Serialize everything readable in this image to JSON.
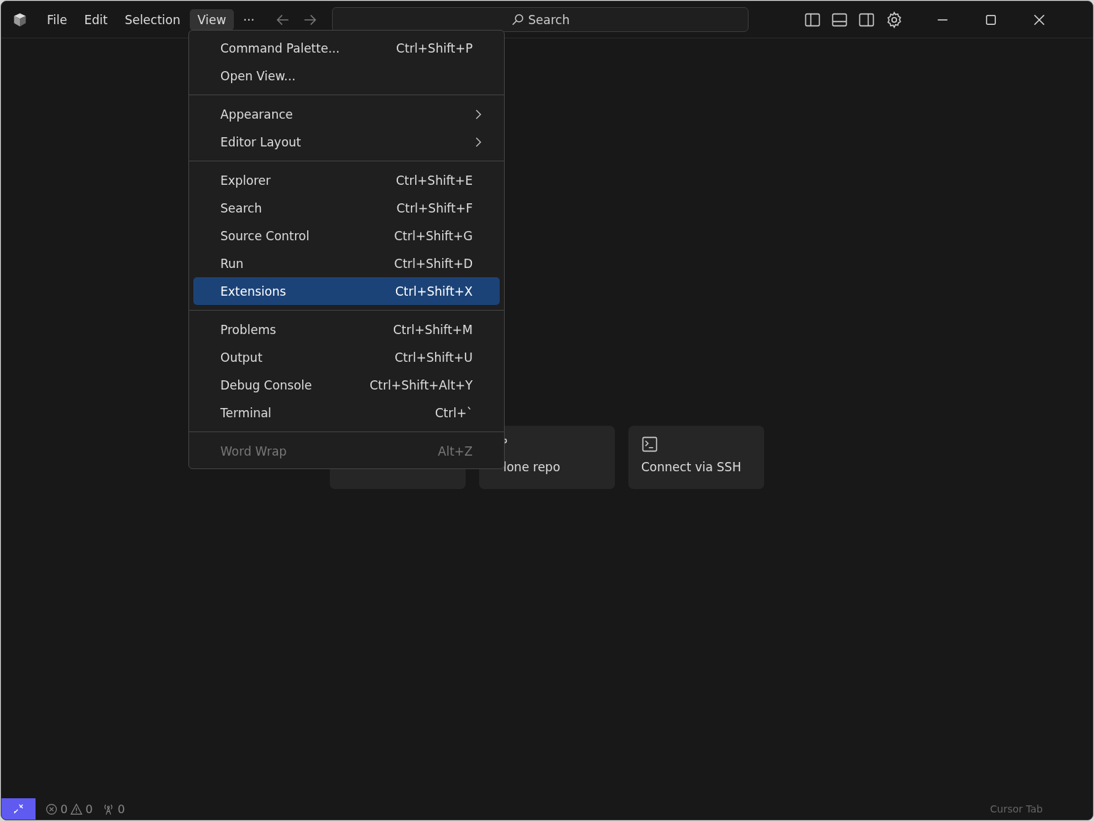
{
  "menubar": [
    {
      "label": "File",
      "selected": false
    },
    {
      "label": "Edit",
      "selected": false
    },
    {
      "label": "Selection",
      "selected": false
    },
    {
      "label": "View",
      "selected": true
    },
    {
      "label": "···",
      "selected": false
    }
  ],
  "search": {
    "placeholder": "Search"
  },
  "view_menu": {
    "groups": [
      [
        {
          "label": "Command Palette...",
          "shortcut": "Ctrl+Shift+P",
          "kind": "command",
          "selected": false,
          "disabled": false
        },
        {
          "label": "Open View...",
          "kind": "command",
          "selected": false,
          "disabled": false
        }
      ],
      [
        {
          "label": "Appearance",
          "kind": "submenu",
          "selected": false,
          "disabled": false
        },
        {
          "label": "Editor Layout",
          "kind": "submenu",
          "selected": false,
          "disabled": false
        }
      ],
      [
        {
          "label": "Explorer",
          "shortcut": "Ctrl+Shift+E",
          "kind": "command",
          "selected": false,
          "disabled": false
        },
        {
          "label": "Search",
          "shortcut": "Ctrl+Shift+F",
          "kind": "command",
          "selected": false,
          "disabled": false
        },
        {
          "label": "Source Control",
          "shortcut": "Ctrl+Shift+G",
          "kind": "command",
          "selected": false,
          "disabled": false
        },
        {
          "label": "Run",
          "shortcut": "Ctrl+Shift+D",
          "kind": "command",
          "selected": false,
          "disabled": false
        },
        {
          "label": "Extensions",
          "shortcut": "Ctrl+Shift+X",
          "kind": "command",
          "selected": true,
          "disabled": false
        }
      ],
      [
        {
          "label": "Problems",
          "shortcut": "Ctrl+Shift+M",
          "kind": "command",
          "selected": false,
          "disabled": false
        },
        {
          "label": "Output",
          "shortcut": "Ctrl+Shift+U",
          "kind": "command",
          "selected": false,
          "disabled": false
        },
        {
          "label": "Debug Console",
          "shortcut": "Ctrl+Shift+Alt+Y",
          "kind": "command",
          "selected": false,
          "disabled": false
        },
        {
          "label": "Terminal",
          "shortcut": "Ctrl+`",
          "kind": "command",
          "selected": false,
          "disabled": false
        }
      ],
      [
        {
          "label": "Word Wrap",
          "shortcut": "Alt+Z",
          "kind": "command",
          "selected": false,
          "disabled": true
        }
      ]
    ]
  },
  "start_cards": [
    {
      "kind": "plain"
    },
    {
      "kind": "branch",
      "label": "lone repo"
    },
    {
      "kind": "terminal",
      "label": "Connect via SSH"
    }
  ],
  "status_bar": {
    "errors": "0",
    "warnings": "0",
    "ports": "0",
    "right": "Cursor Tab"
  }
}
